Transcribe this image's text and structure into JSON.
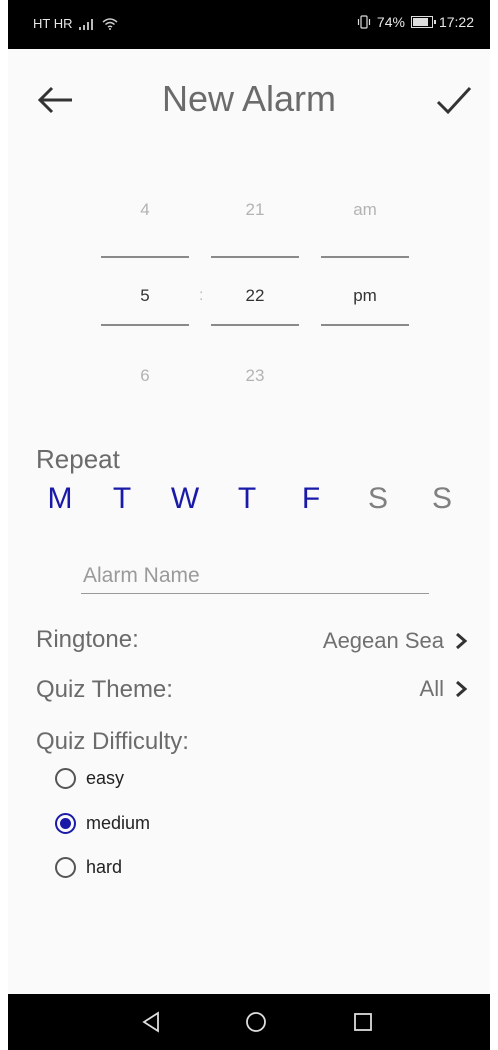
{
  "status_bar": {
    "carrier": "HT HR",
    "battery": "74%",
    "time": "17:22"
  },
  "header": {
    "title": "New Alarm",
    "back_icon": "arrow-left-icon",
    "confirm_icon": "checkmark-icon"
  },
  "time_picker": {
    "hour": {
      "above": "4",
      "current": "5",
      "below": "6"
    },
    "separator": ":",
    "minute": {
      "above": "21",
      "current": "22",
      "below": "23"
    },
    "period": {
      "above": "am",
      "current": "pm"
    }
  },
  "repeat": {
    "label": "Repeat",
    "days": [
      {
        "letter": "M",
        "selected": true
      },
      {
        "letter": "T",
        "selected": true
      },
      {
        "letter": "W",
        "selected": true
      },
      {
        "letter": "T",
        "selected": true
      },
      {
        "letter": "F",
        "selected": true
      },
      {
        "letter": "S",
        "selected": false
      },
      {
        "letter": "S",
        "selected": false
      }
    ],
    "selected_color": "#1a1aa8",
    "unselected_color": "#808080"
  },
  "alarm_name": {
    "value": "",
    "placeholder": "Alarm Name"
  },
  "ringtone": {
    "label": "Ringtone:",
    "value": "Aegean Sea"
  },
  "quiz_theme": {
    "label": "Quiz Theme:",
    "value": "All"
  },
  "quiz_difficulty": {
    "label": "Quiz Difficulty:",
    "options": [
      {
        "label": "easy",
        "checked": false
      },
      {
        "label": "medium",
        "checked": true
      },
      {
        "label": "hard",
        "checked": false
      }
    ]
  },
  "accent_color": "#1a1aa8"
}
